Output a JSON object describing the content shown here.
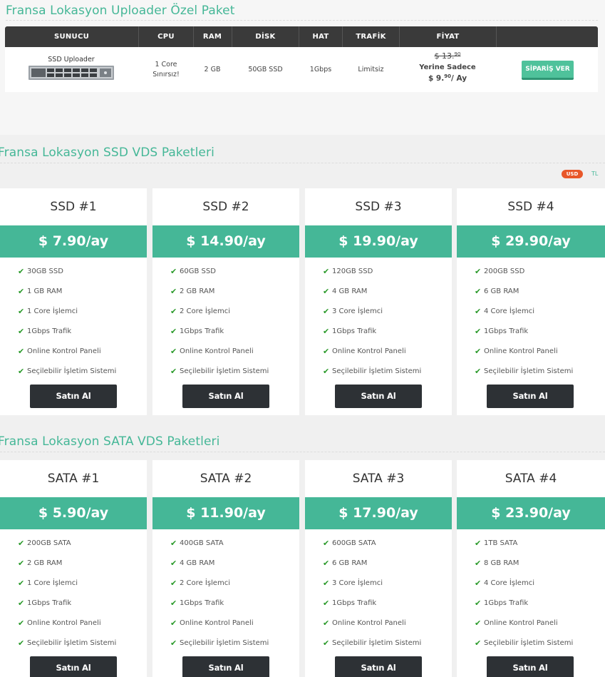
{
  "special": {
    "title": "Fransa Lokasyon Uploader Özel Paket",
    "headers": [
      "SUNUCU",
      "CPU",
      "RAM",
      "DİSK",
      "HAT",
      "TRAFİK",
      "FİYAT"
    ],
    "row": {
      "server_name": "SSD Uploader",
      "cpu_line1": "1 Core",
      "cpu_line2": "Sınırsız!",
      "ram": "2 GB",
      "disk": "50GB SSD",
      "hat": "1Gbps",
      "trafik": "Limitsiz",
      "old_price_main": "$ 13.",
      "old_price_sup": "90",
      "new_price_label": "Yerine Sadece",
      "new_price_main": "$ 9.",
      "new_price_sup": "90",
      "new_price_suffix": "/ Ay",
      "order_label": "SİPARİŞ VER"
    }
  },
  "currency": {
    "usd": "USD",
    "tl": "TL"
  },
  "ssd": {
    "title": "Fransa Lokasyon SSD VDS Paketleri",
    "cards": [
      {
        "name": "SSD #1",
        "price": "$ 7.90/ay",
        "features": [
          "30GB SSD",
          "1 GB RAM",
          "1 Core İşlemci",
          "1Gbps Trafik",
          "Online Kontrol Paneli",
          "Seçilebilir İşletim Sistemi"
        ],
        "button": "Satın Al"
      },
      {
        "name": "SSD #2",
        "price": "$ 14.90/ay",
        "features": [
          "60GB SSD",
          "2 GB RAM",
          "2 Core İşlemci",
          "1Gbps Trafik",
          "Online Kontrol Paneli",
          "Seçilebilir İşletim Sistemi"
        ],
        "button": "Satın Al"
      },
      {
        "name": "SSD #3",
        "price": "$ 19.90/ay",
        "features": [
          "120GB SSD",
          "4 GB RAM",
          "3 Core İşlemci",
          "1Gbps Trafik",
          "Online Kontrol Paneli",
          "Seçilebilir İşletim Sistemi"
        ],
        "button": "Satın Al"
      },
      {
        "name": "SSD #4",
        "price": "$ 29.90/ay",
        "features": [
          "200GB SSD",
          "6 GB RAM",
          "4 Core İşlemci",
          "1Gbps Trafik",
          "Online Kontrol Paneli",
          "Seçilebilir İşletim Sistemi"
        ],
        "button": "Satın Al"
      }
    ]
  },
  "sata": {
    "title": "Fransa Lokasyon SATA VDS Paketleri",
    "cards": [
      {
        "name": "SATA #1",
        "price": "$ 5.90/ay",
        "features": [
          "200GB SATA",
          "2 GB RAM",
          "1 Core İşlemci",
          "1Gbps Trafik",
          "Online Kontrol Paneli",
          "Seçilebilir İşletim Sistemi"
        ],
        "button": "Satın Al"
      },
      {
        "name": "SATA #2",
        "price": "$ 11.90/ay",
        "features": [
          "400GB SATA",
          "4 GB RAM",
          "2 Core İşlemci",
          "1Gbps Trafik",
          "Online Kontrol Paneli",
          "Seçilebilir İşletim Sistemi"
        ],
        "button": "Satın Al"
      },
      {
        "name": "SATA #3",
        "price": "$ 17.90/ay",
        "features": [
          "600GB SATA",
          "6 GB RAM",
          "3 Core İşlemci",
          "1Gbps Trafik",
          "Online Kontrol Paneli",
          "Seçilebilir İşletim Sistemi"
        ],
        "button": "Satın Al"
      },
      {
        "name": "SATA #4",
        "price": "$ 23.90/ay",
        "features": [
          "1TB SATA",
          "8 GB RAM",
          "4 Core İşlemci",
          "1Gbps Trafik",
          "Online Kontrol Paneli",
          "Seçilebilir İşletim Sistemi"
        ],
        "button": "Satın Al"
      }
    ]
  }
}
